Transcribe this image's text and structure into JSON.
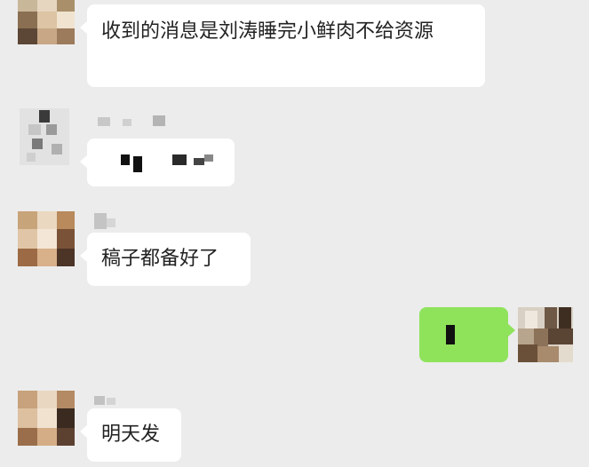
{
  "messages": [
    {
      "side": "left",
      "text": "收到的消息是刘涛睡完小鲜肉不给资源"
    },
    {
      "side": "left",
      "text": ""
    },
    {
      "side": "left",
      "text": "稿子都备好了"
    },
    {
      "side": "right",
      "text": ""
    },
    {
      "side": "left",
      "text": "明天发"
    }
  ],
  "colors": {
    "background": "#ececec",
    "incoming_bubble": "#ffffff",
    "outgoing_bubble": "#8fe35b"
  }
}
